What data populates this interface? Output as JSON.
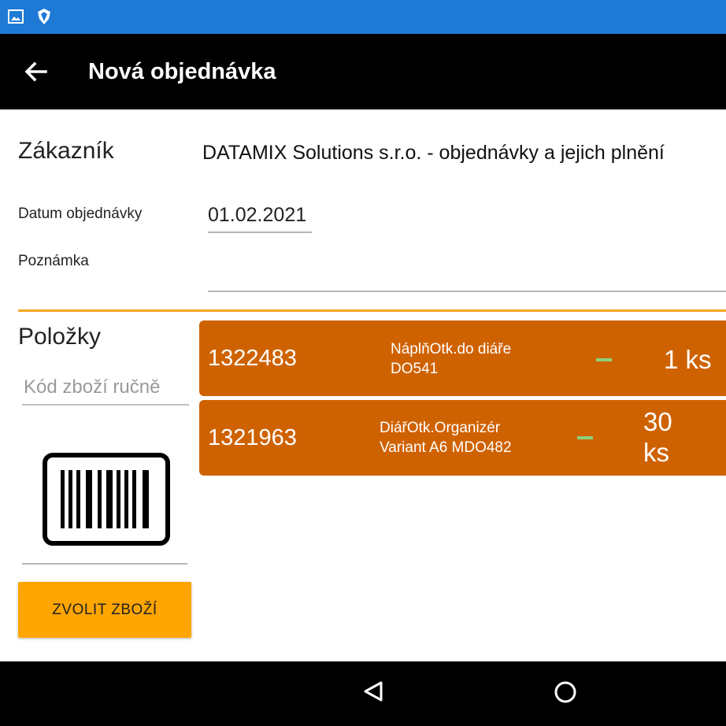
{
  "status_bar": {
    "icons": [
      "image-icon",
      "shield-icon"
    ]
  },
  "app_bar": {
    "back_icon": "arrow-left-icon",
    "title": "Nová objednávka"
  },
  "form": {
    "customer_label": "Zákazník",
    "customer_value": "DATAMIX Solutions s.r.o. - objednávky a jejich plnění",
    "date_label": "Datum objednávky",
    "date_value": "01.02.2021",
    "note_label": "Poznámka",
    "note_value": ""
  },
  "items_panel": {
    "label": "Položky",
    "code_placeholder": "Kód zboží ručně",
    "barcode_icon": "barcode-icon",
    "select_button": "ZVOLIT ZBOŽÍ"
  },
  "items": [
    {
      "code": "1322483",
      "name": "NáplňOtk.do diáře\nDO541",
      "quantity": "1 ks"
    },
    {
      "code": "1321963",
      "name": "DiářOtk.Organizér\nVariant A6 MDO482",
      "quantity": "30\nks"
    }
  ],
  "nav_bar": {
    "icons": [
      "back-triangle-icon",
      "home-circle-icon"
    ]
  },
  "colors": {
    "status_bar": "#1f7ad6",
    "accent": "#f5a623",
    "item_bg": "#cf6200",
    "button": "#ffa500",
    "minus": "#8bd17c"
  }
}
